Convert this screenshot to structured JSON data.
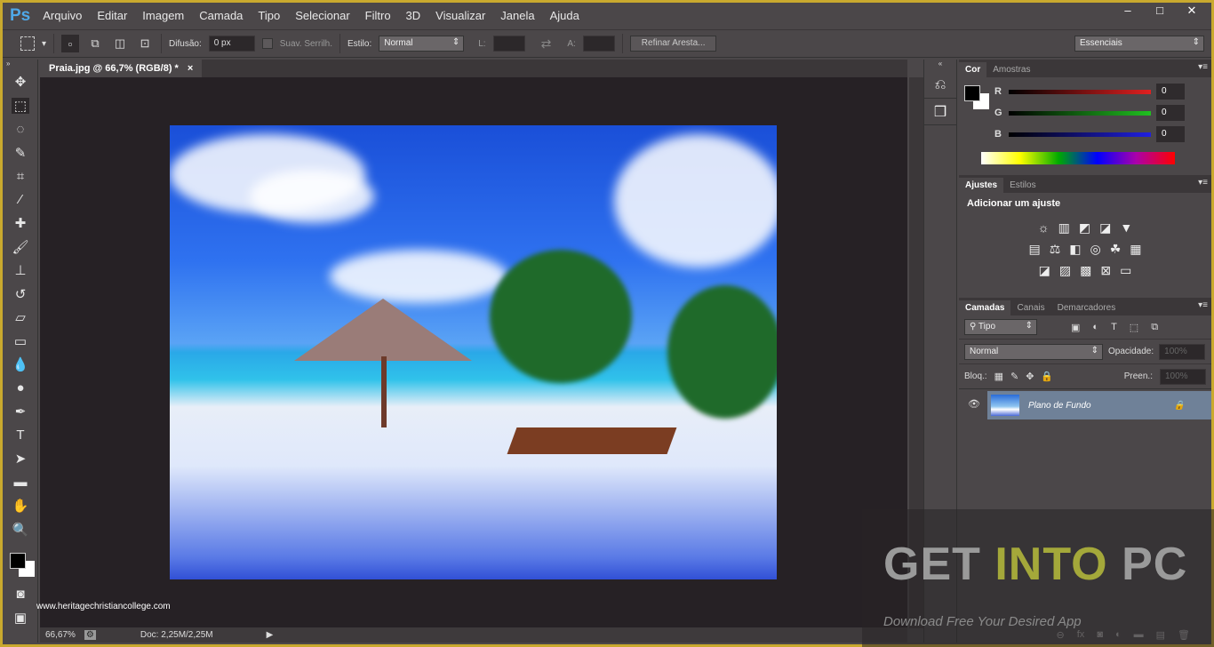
{
  "app": {
    "logo": "Ps",
    "window_buttons": [
      "–",
      "□",
      "✕"
    ]
  },
  "menu": [
    "Arquivo",
    "Editar",
    "Imagem",
    "Camada",
    "Tipo",
    "Selecionar",
    "Filtro",
    "3D",
    "Visualizar",
    "Janela",
    "Ajuda"
  ],
  "options": {
    "feather_label": "Difusão:",
    "feather_value": "0 px",
    "antialias_label": "Suav. Serrilh.",
    "style_label": "Estilo:",
    "style_value": "Normal",
    "width_label": "L:",
    "height_label": "A:",
    "refine_label": "Refinar Aresta...",
    "workspace": "Essenciais"
  },
  "document": {
    "tab_title": "Praia.jpg @ 66,7% (RGB/8) *",
    "close": "×"
  },
  "status": {
    "zoom": "66,67%",
    "doc": "Doc: 2,25M/2,25M"
  },
  "overlay_url": "www.heritagechristiancollege.com",
  "color_panel": {
    "tabs": [
      "Cor",
      "Amostras"
    ],
    "channels": [
      {
        "label": "R",
        "value": "0",
        "color": "#e02020"
      },
      {
        "label": "G",
        "value": "0",
        "color": "#20c020"
      },
      {
        "label": "B",
        "value": "0",
        "color": "#2020e0"
      }
    ]
  },
  "adjust_panel": {
    "tabs": [
      "Ajustes",
      "Estilos"
    ],
    "title": "Adicionar um ajuste"
  },
  "layers_panel": {
    "tabs": [
      "Camadas",
      "Canais",
      "Demarcadores"
    ],
    "filter": "Tipo",
    "blend": "Normal",
    "opacity_label": "Opacidade:",
    "opacity": "100%",
    "lock_label": "Bloq.:",
    "fill_label": "Preen.:",
    "fill": "100%",
    "layers": [
      {
        "name": "Plano de Fundo",
        "locked": true,
        "visible": true
      }
    ]
  },
  "watermark": {
    "get": "GET",
    "into": "INTO",
    "pc": "PC",
    "tagline": "Download Free Your Desired App",
    "into_color": "#a4a83a"
  }
}
